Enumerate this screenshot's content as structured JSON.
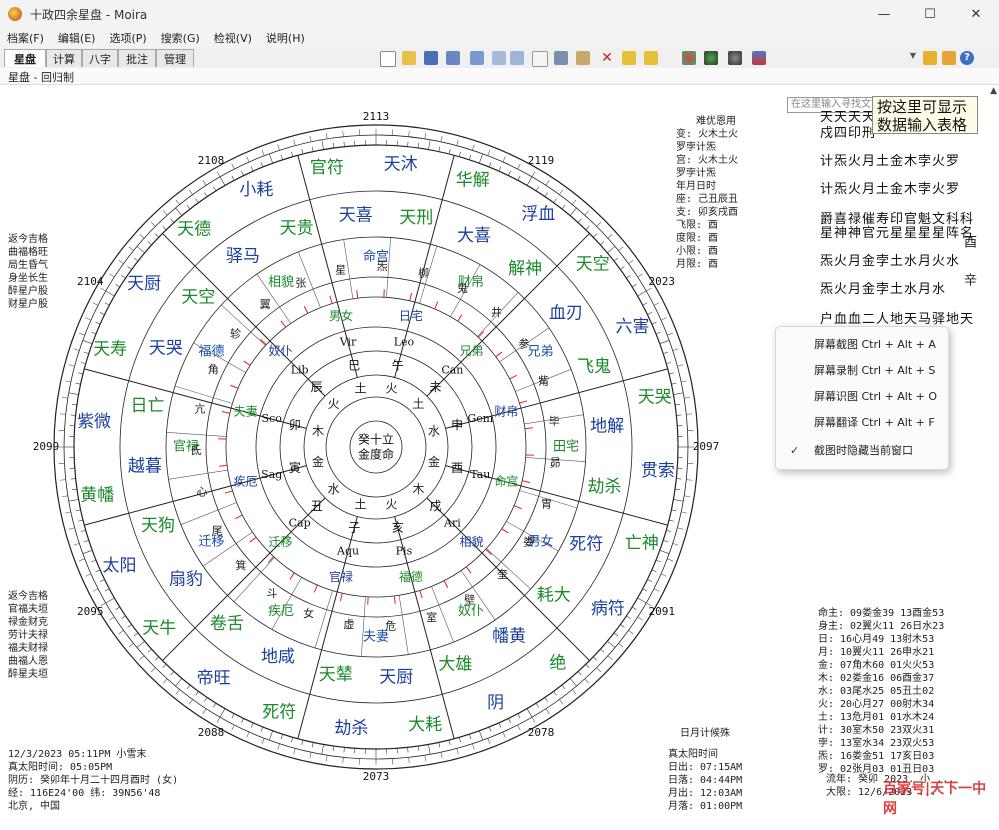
{
  "window": {
    "title": "十政四余星盘 - Moira",
    "minimize": "—",
    "maximize": "☐",
    "close": "✕",
    "icon": "moira-app-icon"
  },
  "menu": [
    "档案(F)",
    "编辑(E)",
    "选项(P)",
    "搜索(G)",
    "检视(V)",
    "说明(H)"
  ],
  "tabs": [
    "星盘",
    "计算",
    "八字",
    "批注",
    "管理"
  ],
  "search": {
    "placeholder": "在这里输入寻找文字..."
  },
  "subtitle": "星盘 - 回归制",
  "tooltip": [
    "按这里可显示",
    "数据输入表格"
  ],
  "context_menu": [
    {
      "label": "屏幕截图 Ctrl + Alt + A",
      "checked": false
    },
    {
      "label": "屏幕录制 Ctrl + Alt + S",
      "checked": false
    },
    {
      "label": "屏幕识图 Ctrl + Alt + O",
      "checked": false
    },
    {
      "label": "屏幕翻译 Ctrl + Alt + F",
      "checked": false
    },
    {
      "label": "截图时隐藏当前窗口",
      "checked": true
    }
  ],
  "right_top_header": "难优恩用",
  "right_top_rows": [
    "变: 火木土火",
    "罗孛计炁",
    "宫: 火木土火",
    "罗孛计炁",
    "年月日时",
    "座: 己丑辰丑",
    "支: 卯亥戌酉",
    "飞限: 酉",
    "度限: 酉",
    "小限: 酉",
    "月限: 酉"
  ],
  "left_mid": [
    "返今吉格",
    "曲福格旺",
    "局生昏气",
    "身坐长生",
    "醉星户股",
    "财星户股"
  ],
  "left_low": [
    "返今吉格",
    "官福夫垣",
    "禄金财克",
    "劳计夫禄",
    "福夫财禄",
    "曲福人恩",
    "醉星夫垣"
  ],
  "birth": [
    "12/3/2023 05:11PM 小雪末",
    "真太阳时间: 05:05PM",
    "阴历: 癸卯年十月二十四月酉时 (女)",
    "经: 116E24'00  纬: 39N56'48",
    "北京, 中国"
  ],
  "sun_moon_title": "日月计候殊",
  "sun_moon_rows": [
    "真太阳时间",
    "日出: 07:15AM",
    "日落: 04:44PM",
    "月出: 12:03AM",
    "月落: 01:00PM"
  ],
  "planets": [
    "命主: 09娄金39   13酉金53",
    "身主: 02翼火11   26日水23",
    "日: 16心月49    13射木53",
    "月: 10翼火11    26申水21",
    "金: 07角木60    01火火53",
    "木: 02娄金16    06酉金37",
    "水: 03尾水25    05丑土02",
    "火: 20心月27    00射木34",
    "土: 13危月01    01水木24",
    "计: 30室木50    23双火31",
    "孛: 13室水34    23双火53",
    "炁: 16娄金51    17亥日03",
    "罗: 02张月03    01丑日03"
  ],
  "flow": [
    "流年: 癸卯 2023. 小 ...",
    "大限: 12/6/2023 ..."
  ],
  "side_bar_left": "酉",
  "side_bar_right": "辛",
  "right_cols": [
    "天天天天",
    "戍四印刑",
    "计炁火月土金木孛火罗",
    "计炁火月土金木孛火罗",
    "爵喜禄催寿印官魁文科科",
    "星神神官元星星星星阵名",
    "炁火月金孛土水月火水",
    "炁火月金孛土水月水",
    "户血血二人地天马驿地天",
    "天天天天"
  ],
  "watermark": "百家号|天下一中网",
  "compass": [
    "2113",
    "2108",
    "2119",
    "2104",
    "2023",
    "2099",
    "2097",
    "2095",
    "2091",
    "2088",
    "2078",
    "2073"
  ],
  "houses": [
    {
      "label": "命宫",
      "color": "#1b4fa8"
    },
    {
      "label": "财帛",
      "color": "#1a8a2a"
    },
    {
      "label": "兄弟",
      "color": "#1b4fa8"
    },
    {
      "label": "田宅",
      "color": "#1a8a2a"
    },
    {
      "label": "男女",
      "color": "#1b4fa8"
    },
    {
      "label": "奴仆",
      "color": "#1a8a2a"
    },
    {
      "label": "夫妻",
      "color": "#1b4fa8"
    },
    {
      "label": "疾厄",
      "color": "#1a8a2a"
    },
    {
      "label": "迁移",
      "color": "#1b4fa8"
    },
    {
      "label": "官禄",
      "color": "#1a8a2a"
    },
    {
      "label": "福德",
      "color": "#1b4fa8"
    },
    {
      "label": "相貌",
      "color": "#1a8a2a"
    }
  ],
  "center": [
    "癸十立",
    "金度命"
  ],
  "ring_outer_words": [
    "天沐",
    "华解",
    "浮血",
    "天空",
    "六害",
    "天哭",
    "贯索",
    "亡神",
    "病符",
    "绝",
    "阴",
    "大耗",
    "劫杀",
    "死符",
    "帝旺",
    "天牛",
    "太阳",
    "黄幡",
    "紫微",
    "天寿",
    "天厨",
    "天德",
    "小耗",
    "官符"
  ],
  "ring_mid_words": [
    "天刑",
    "大喜",
    "解神",
    "血刃",
    "飞鬼",
    "地解",
    "劫杀",
    "死符",
    "耗大",
    "幡黄",
    "大雄",
    "天厨",
    "天辇",
    "地咸",
    "卷舌",
    "扇豹",
    "天狗",
    "越暮",
    "日亡",
    "天哭",
    "天空",
    "驿马",
    "天贵",
    "天喜"
  ],
  "ring_inner_words": [
    "炁",
    "柳",
    "鬼",
    "井",
    "参",
    "觜",
    "毕",
    "昴",
    "胃",
    "娄",
    "奎",
    "壁",
    "室",
    "危",
    "虚",
    "女",
    "斗",
    "箕",
    "尾",
    "心",
    "氐",
    "亢",
    "角",
    "轸",
    "翼",
    "张",
    "星"
  ],
  "ring_branch": [
    "午",
    "未",
    "申",
    "酉",
    "戌",
    "亥",
    "子",
    "丑",
    "寅",
    "卯",
    "辰",
    "巳"
  ],
  "ring_gz": [
    "日宅",
    "兄弟",
    "财帛",
    "命宫",
    "相貌",
    "福德",
    "官禄",
    "迁移",
    "疾厄",
    "夫妻",
    "奴仆",
    "男女"
  ],
  "ring_signs": [
    "Leo",
    "Can",
    "Gem",
    "Tau",
    "Ari",
    "Pis",
    "Aqu",
    "Cap",
    "Sag",
    "Sco",
    "Lib",
    "Vir"
  ],
  "ring_inner_el": [
    "火",
    "土",
    "水",
    "金",
    "木",
    "火",
    "土",
    "水",
    "金",
    "木",
    "火",
    "土"
  ]
}
